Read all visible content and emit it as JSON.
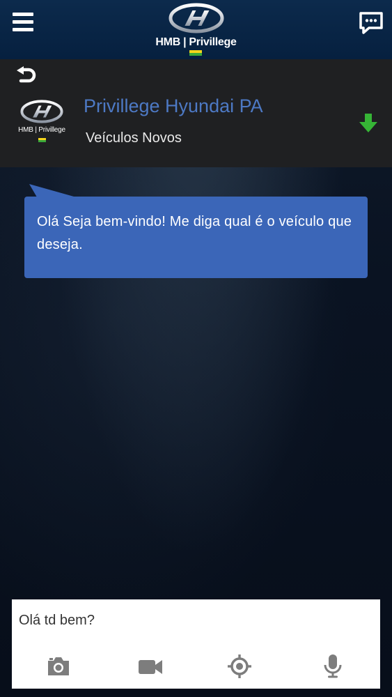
{
  "header": {
    "brand_text": "HMB | Privillege",
    "menu_icon": "hamburger-menu-icon",
    "chat_icon": "chat-bubble-icon"
  },
  "panel": {
    "logo_text": "HMB | Privillege",
    "store_name": "Privillege Hyundai PA",
    "store_subtitle": "Veículos Novos",
    "back_icon": "undo-arrow-icon",
    "download_icon": "arrow-down-icon"
  },
  "chat": {
    "messages": [
      {
        "from": "bot",
        "text": "Olá Seja bem-vindo! Me diga qual é o veículo que deseja."
      }
    ]
  },
  "composer": {
    "input_value": "Olá td bem?",
    "tools": [
      "camera-icon",
      "video-camera-icon",
      "location-target-icon",
      "microphone-icon"
    ]
  },
  "colors": {
    "topbar": "#06203f",
    "panel": "#1f2022",
    "accent_blue": "#4d79c4",
    "bubble": "#3b66b8",
    "download_green": "#36b536",
    "tool_gray": "#7d7d7d"
  }
}
